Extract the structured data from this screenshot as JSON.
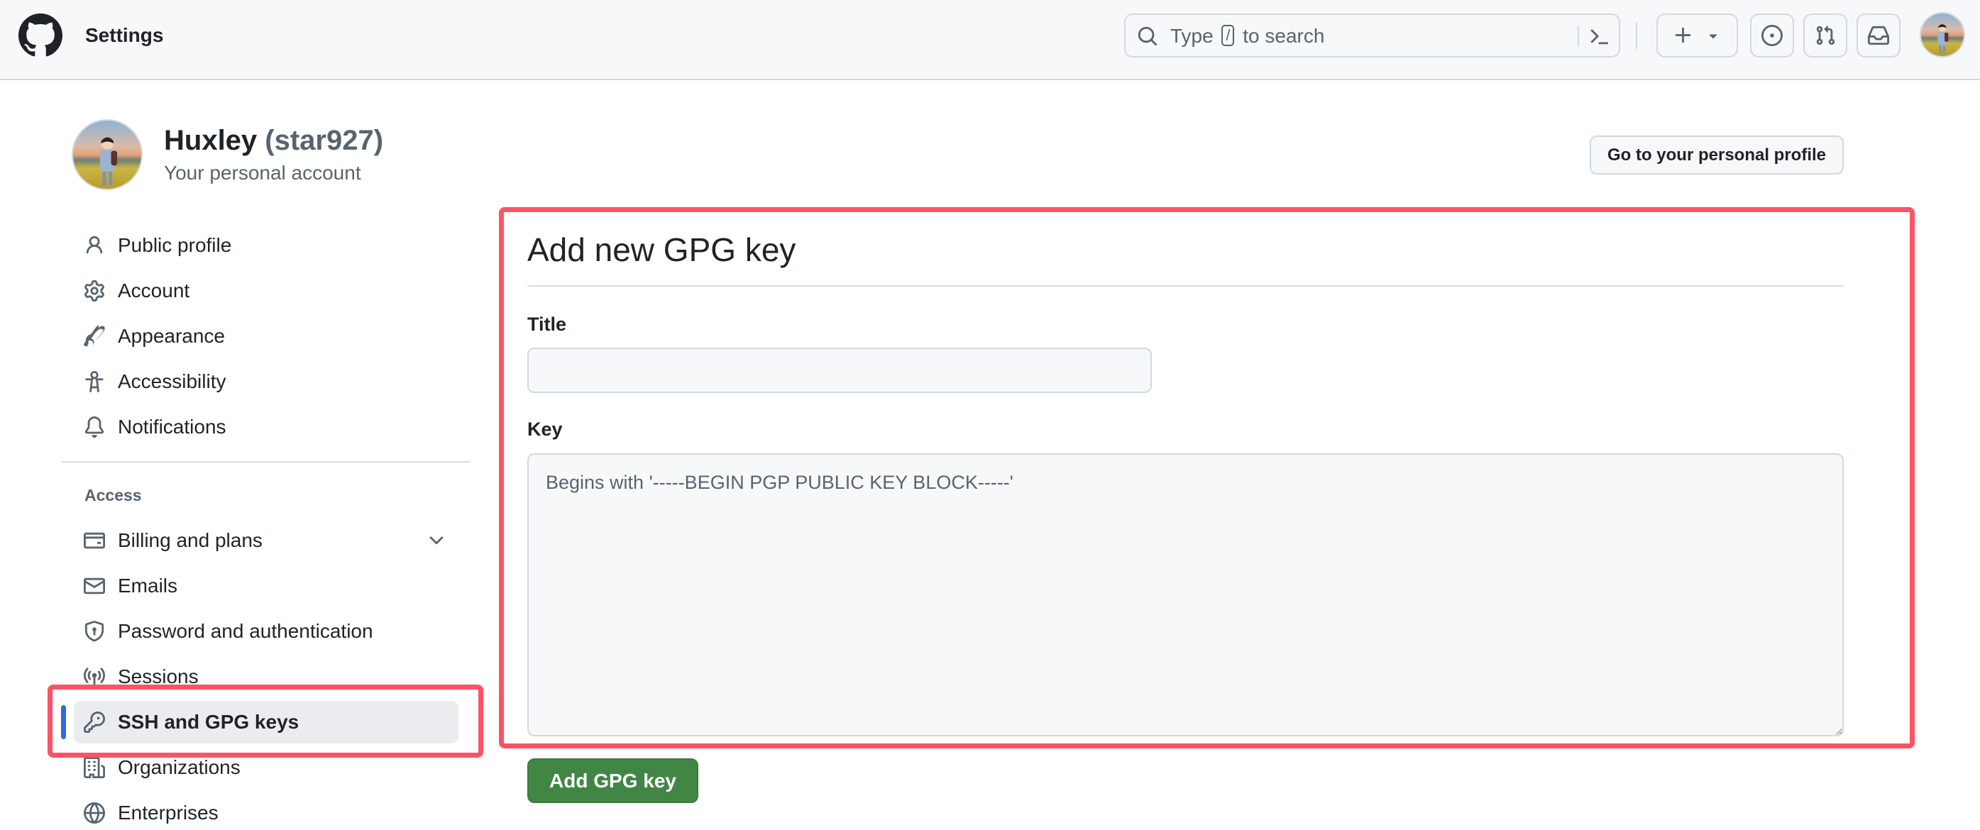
{
  "header": {
    "app_title": "Settings",
    "logo_icon": "github-mark-icon",
    "search": {
      "prefix": "Type",
      "shortcut_key": "/",
      "suffix": "to search",
      "icon": "search-icon",
      "command_palette_icon": "terminal-icon"
    },
    "actions": [
      {
        "name": "create-new",
        "icon": "plus-icon",
        "has_dropdown": true
      },
      {
        "name": "issues",
        "icon": "issue-opened-icon"
      },
      {
        "name": "pull-requests",
        "icon": "git-pull-request-icon"
      },
      {
        "name": "inbox",
        "icon": "inbox-icon"
      }
    ],
    "user_avatar": "user-avatar"
  },
  "profile": {
    "display_name": "Huxley",
    "login": "(star927)",
    "subtitle": "Your personal account",
    "profile_button_label": "Go to your personal profile"
  },
  "sidebar": {
    "items": [
      {
        "label": "Public profile",
        "icon": "person-icon"
      },
      {
        "label": "Account",
        "icon": "gear-icon"
      },
      {
        "label": "Appearance",
        "icon": "paintbrush-icon"
      },
      {
        "label": "Accessibility",
        "icon": "accessibility-icon"
      },
      {
        "label": "Notifications",
        "icon": "bell-icon"
      }
    ],
    "access_heading": "Access",
    "access_items": [
      {
        "label": "Billing and plans",
        "icon": "credit-card-icon",
        "expandable": true
      },
      {
        "label": "Emails",
        "icon": "mail-icon"
      },
      {
        "label": "Password and authentication",
        "icon": "shield-lock-icon"
      },
      {
        "label": "Sessions",
        "icon": "broadcast-icon"
      },
      {
        "label": "SSH and GPG keys",
        "icon": "key-icon",
        "active": true
      },
      {
        "label": "Organizations",
        "icon": "organization-icon"
      },
      {
        "label": "Enterprises",
        "icon": "globe-icon"
      }
    ]
  },
  "main": {
    "title": "Add new GPG key",
    "title_field": {
      "label": "Title",
      "value": "",
      "placeholder": ""
    },
    "key_field": {
      "label": "Key",
      "value": "",
      "placeholder": "Begins with '-----BEGIN PGP PUBLIC KEY BLOCK-----'"
    },
    "submit_label": "Add GPG key"
  },
  "colors": {
    "accent_blue": "#2f6be0",
    "primary_button": "#428646",
    "highlight_annotation": "#ff5266",
    "header_bg": "#f6f8fa",
    "muted_text": "#59636e"
  }
}
